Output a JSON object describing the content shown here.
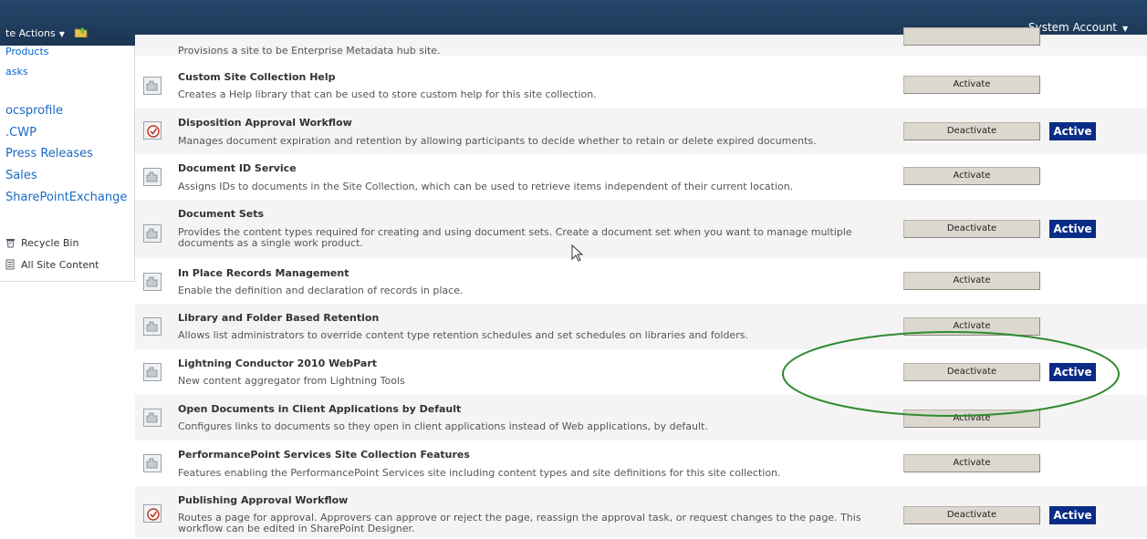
{
  "header": {
    "site_actions": "te Actions",
    "system_account": "System Account"
  },
  "left_nav": {
    "items": [
      {
        "label": "Products",
        "size": "small"
      },
      {
        "label": "asks",
        "size": "small"
      },
      {
        "label": "ocsprofile",
        "size": "large"
      },
      {
        "label": ".CWP",
        "size": "large"
      },
      {
        "label": "Press Releases",
        "size": "large"
      },
      {
        "label": "Sales",
        "size": "large"
      },
      {
        "label": "SharePointExchange",
        "size": "large"
      }
    ],
    "utility": [
      {
        "label": "Recycle Bin",
        "icon": "recycle-bin-icon"
      },
      {
        "label": "All Site Content",
        "icon": "site-content-icon"
      }
    ]
  },
  "features": [
    {
      "title": "",
      "description": "Provisions a site to be Enterprise Metadata hub site.",
      "button": "",
      "status": "",
      "icon": "feature-icon"
    },
    {
      "title": "Custom Site Collection Help",
      "description": "Creates a Help library that can be used to store custom help for this site collection.",
      "button": "Activate",
      "status": "",
      "icon": "feature-icon"
    },
    {
      "title": "Disposition Approval Workflow",
      "description": "Manages document expiration and retention by allowing participants to decide whether to retain or delete expired documents.",
      "button": "Deactivate",
      "status": "Active",
      "icon": "workflow-icon"
    },
    {
      "title": "Document ID Service",
      "description": "Assigns IDs to documents in the Site Collection, which can be used to retrieve items independent of their current location.",
      "button": "Activate",
      "status": "",
      "icon": "feature-icon"
    },
    {
      "title": "Document Sets",
      "description": "Provides the content types required for creating and using document sets. Create a document set when you want to manage multiple documents as a single work product.",
      "button": "Deactivate",
      "status": "Active",
      "icon": "feature-icon"
    },
    {
      "title": "In Place Records Management",
      "description": "Enable the definition and declaration of records in place.",
      "button": "Activate",
      "status": "",
      "icon": "feature-icon"
    },
    {
      "title": "Library and Folder Based Retention",
      "description": "Allows list administrators to override content type retention schedules and set schedules on libraries and folders.",
      "button": "Activate",
      "status": "",
      "icon": "feature-icon"
    },
    {
      "title": "Lightning Conductor 2010 WebPart",
      "description": "New content aggregator from Lightning Tools",
      "button": "Deactivate",
      "status": "Active",
      "icon": "feature-icon"
    },
    {
      "title": "Open Documents in Client Applications by Default",
      "description": "Configures links to documents so they open in client applications instead of Web applications, by default.",
      "button": "Activate",
      "status": "",
      "icon": "feature-icon"
    },
    {
      "title": "PerformancePoint Services Site Collection Features",
      "description": "Features enabling the PerformancePoint Services site including content types and site definitions for this site collection.",
      "button": "Activate",
      "status": "",
      "icon": "feature-icon"
    },
    {
      "title": "Publishing Approval Workflow",
      "description": "Routes a page for approval. Approvers can approve or reject the page, reassign the approval task, or request changes to the page. This workflow can be edited in SharePoint Designer.",
      "button": "Deactivate",
      "status": "Active",
      "icon": "workflow-icon"
    }
  ],
  "colors": {
    "header_bg": "#1f3d5e",
    "active_badge": "#0a2c87",
    "link": "#0066cc",
    "highlight_ellipse": "#2e8b2e"
  }
}
